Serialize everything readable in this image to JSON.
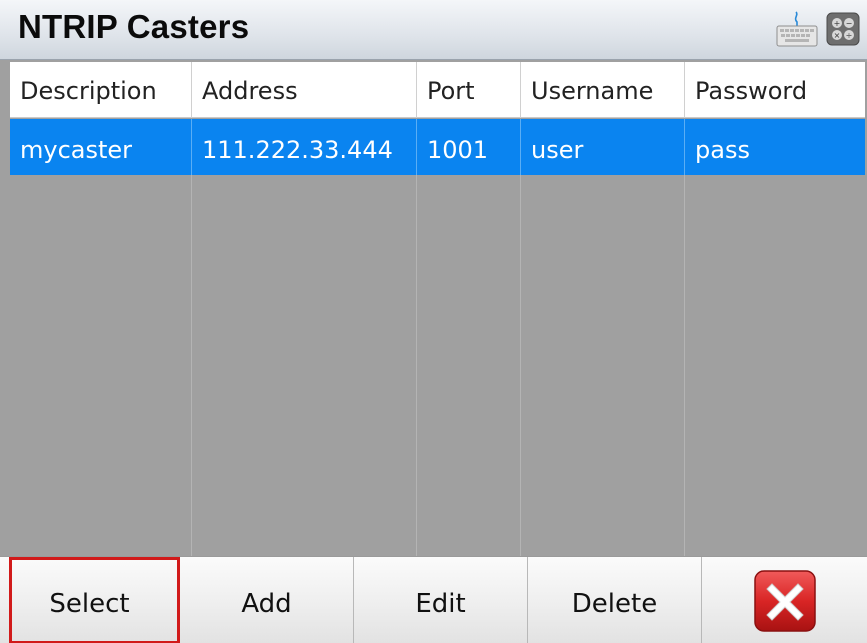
{
  "window": {
    "title": "NTRIP Casters"
  },
  "icons": {
    "keyboard": "keyboard-icon",
    "calculator": "calculator-icon",
    "close": "close-icon"
  },
  "table": {
    "columns": [
      "Description",
      "Address",
      "Port",
      "Username",
      "Password"
    ],
    "rows": [
      {
        "description": "mycaster",
        "address": "111.222.33.444",
        "port": "1001",
        "username": "user",
        "password": "pass",
        "selected": true
      }
    ]
  },
  "toolbar": {
    "select_label": "Select",
    "add_label": "Add",
    "edit_label": "Edit",
    "delete_label": "Delete"
  },
  "colors": {
    "selection": "#0a84f0",
    "background": "#a0a0a0",
    "highlight_outline": "#d11a1a",
    "close_red": "#d92525"
  }
}
